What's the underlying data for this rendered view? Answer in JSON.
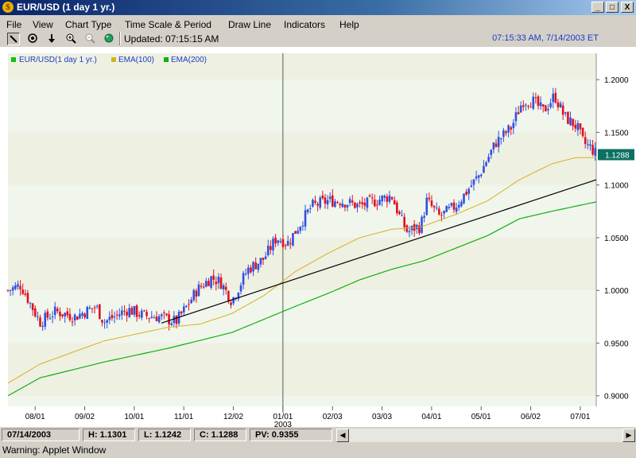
{
  "window": {
    "title": "EUR/USD (1 day  1 yr.)",
    "min_btn": "_",
    "max_btn": "□",
    "close_btn": "X"
  },
  "menu": [
    "File",
    "View",
    "Chart Type",
    "Time Scale & Period",
    "Draw Line",
    "Indicators",
    "Help"
  ],
  "toolbar": {
    "updated": "Updated: 07:15:15 AM",
    "clock": "07:15:33 AM, 7/14/2003 ET"
  },
  "status": {
    "date": "07/14/2003",
    "high": "H: 1.1301",
    "low": "L: 1.1242",
    "close": "C: 1.1288",
    "pv": "PV: 0.9355"
  },
  "warning": "Warning: Applet Window",
  "colors": {
    "up": "#3050e0",
    "down": "#e01020",
    "ema100": "#d8b020",
    "ema200": "#10b010",
    "trend": "#000000",
    "band_a": "#f0f6ec",
    "band_b": "#eef0e2",
    "price_tag": "#0a7060"
  },
  "chart_data": {
    "type": "candlestick",
    "legend": [
      "EUR/USD(1 day  1 yr.)",
      "EMA(100)",
      "EMA(200)"
    ],
    "ylim": [
      0.89,
      1.225
    ],
    "yticks": [
      "1.2000",
      "1.1500",
      "1.1000",
      "1.0500",
      "1.0000",
      "0.9500",
      "0.9000"
    ],
    "xlabels": [
      "08/01",
      "09/02",
      "10/01",
      "11/01",
      "12/02",
      "01/01",
      "02/03",
      "03/03",
      "04/01",
      "05/01",
      "06/02",
      "07/01"
    ],
    "year_label": "2003",
    "last_price": "1.1288",
    "close_path": [
      [
        0,
        1.0
      ],
      [
        8,
        1.005
      ],
      [
        20,
        0.97
      ],
      [
        30,
        0.98
      ],
      [
        42,
        0.975
      ],
      [
        55,
        0.985
      ],
      [
        60,
        0.97
      ],
      [
        75,
        0.982
      ],
      [
        85,
        0.976
      ],
      [
        95,
        0.975
      ],
      [
        105,
        0.97
      ],
      [
        112,
        0.985
      ],
      [
        118,
        1.0
      ],
      [
        127,
        1.012
      ],
      [
        133,
        1.008
      ],
      [
        140,
        0.99
      ],
      [
        150,
        1.02
      ],
      [
        160,
        1.03
      ],
      [
        168,
        1.05
      ],
      [
        175,
        1.045
      ],
      [
        190,
        1.08
      ],
      [
        200,
        1.085
      ],
      [
        208,
        1.085
      ],
      [
        220,
        1.08
      ],
      [
        230,
        1.085
      ],
      [
        240,
        1.09
      ],
      [
        245,
        1.07
      ],
      [
        250,
        1.055
      ],
      [
        255,
        1.06
      ],
      [
        258,
        1.06
      ],
      [
        262,
        1.085
      ],
      [
        270,
        1.07
      ],
      [
        280,
        1.08
      ],
      [
        295,
        1.11
      ],
      [
        305,
        1.14
      ],
      [
        315,
        1.155
      ],
      [
        322,
        1.18
      ],
      [
        328,
        1.18
      ],
      [
        335,
        1.17
      ],
      [
        342,
        1.185
      ],
      [
        348,
        1.165
      ],
      [
        356,
        1.155
      ],
      [
        360,
        1.14
      ],
      [
        365,
        1.135
      ],
      [
        368,
        1.1288
      ]
    ],
    "ema100_path": [
      [
        0,
        0.912
      ],
      [
        20,
        0.93
      ],
      [
        60,
        0.952
      ],
      [
        100,
        0.965
      ],
      [
        120,
        0.968
      ],
      [
        140,
        0.978
      ],
      [
        160,
        0.995
      ],
      [
        180,
        1.018
      ],
      [
        200,
        1.035
      ],
      [
        220,
        1.05
      ],
      [
        240,
        1.058
      ],
      [
        258,
        1.06
      ],
      [
        280,
        1.072
      ],
      [
        300,
        1.085
      ],
      [
        320,
        1.105
      ],
      [
        340,
        1.12
      ],
      [
        355,
        1.126
      ],
      [
        368,
        1.126
      ]
    ],
    "ema200_path": [
      [
        0,
        0.9
      ],
      [
        20,
        0.917
      ],
      [
        60,
        0.932
      ],
      [
        100,
        0.945
      ],
      [
        140,
        0.96
      ],
      [
        180,
        0.985
      ],
      [
        200,
        0.997
      ],
      [
        220,
        1.01
      ],
      [
        240,
        1.02
      ],
      [
        260,
        1.028
      ],
      [
        280,
        1.04
      ],
      [
        300,
        1.052
      ],
      [
        320,
        1.068
      ],
      [
        340,
        1.075
      ],
      [
        368,
        1.084
      ]
    ],
    "trendline": [
      [
        96,
        0.969
      ],
      [
        368,
        1.105
      ]
    ],
    "vline_at": 172,
    "x_ticks_at": [
      17,
      48,
      79,
      110,
      141,
      172,
      203,
      234,
      265,
      296,
      327,
      358
    ]
  }
}
